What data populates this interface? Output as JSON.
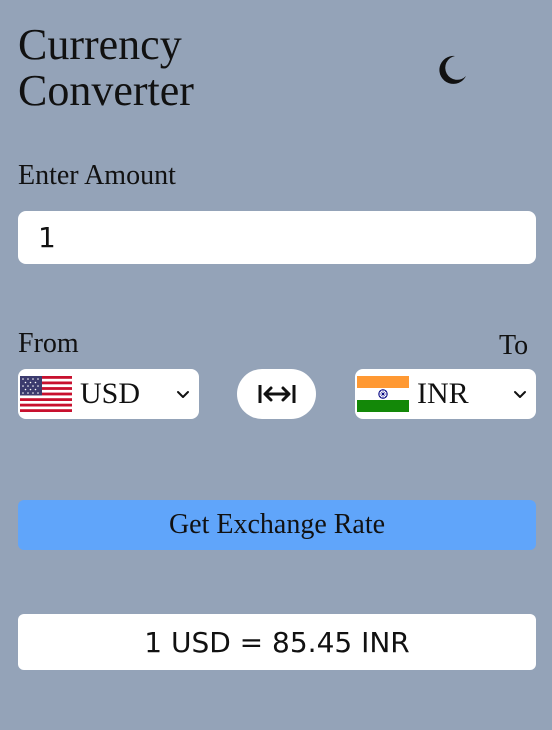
{
  "header": {
    "title_line1": "Currency",
    "title_line2": "Converter",
    "theme_icon": "moon-icon"
  },
  "amount": {
    "label": "Enter Amount",
    "value": "1"
  },
  "from": {
    "label": "From",
    "currency": "USD",
    "flag": "us-flag-icon"
  },
  "to": {
    "label": "To",
    "currency": "INR",
    "flag": "india-flag-icon"
  },
  "swap": {
    "icon": "swap-arrows-icon"
  },
  "button": {
    "label": "Get Exchange Rate"
  },
  "result": {
    "text": "1 USD = 85.45 INR"
  },
  "colors": {
    "background": "#94a3b8",
    "button": "#60a5fa",
    "surface": "#ffffff"
  }
}
